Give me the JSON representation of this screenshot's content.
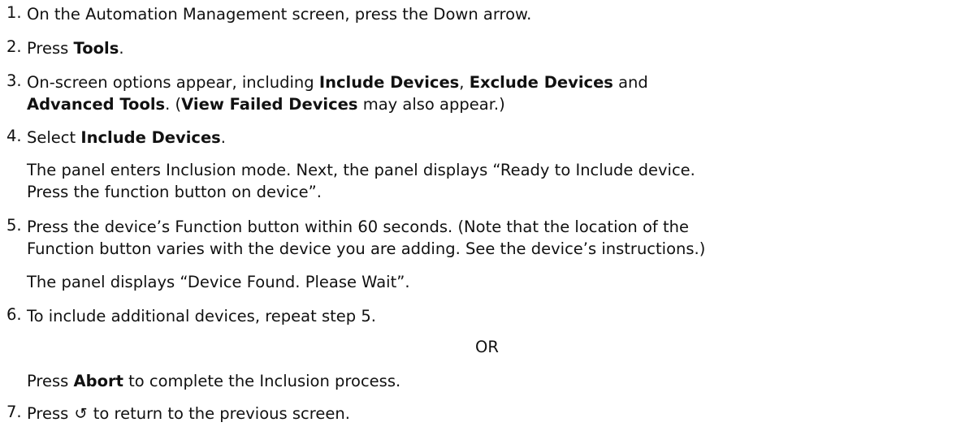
{
  "steps": [
    {
      "number": "1.",
      "text": "On the Automation Management screen, press the Down arrow."
    },
    {
      "number": "2.",
      "pre": "Press ",
      "bold": "Tools",
      "post": "."
    },
    {
      "number": "3.",
      "line1_pre": "On-screen options appear, including ",
      "line1_bold1": "Include Devices",
      "line1_mid": ", ",
      "line1_bold2": "Exclude Devices",
      "line1_post": " and",
      "line2_bold1": "Advanced Tools",
      "line2_mid": ". (",
      "line2_bold2": "View Failed Devices",
      "line2_post": " may also appear.)"
    },
    {
      "number": "4.",
      "pre": "Select ",
      "bold": "Include Devices",
      "post": ".",
      "note_line1": "The panel enters Inclusion mode. Next, the panel displays “Ready to Include device.",
      "note_line2": "Press the function button on device”."
    },
    {
      "number": "5.",
      "line1": "Press the device’s Function button within 60 seconds. (Note that the location of the",
      "line2": "Function button varies with the device you are adding. See the device’s instructions.)",
      "note": "The panel displays “Device Found. Please Wait”."
    },
    {
      "number": "6.",
      "text": "To include additional devices, repeat step 5.",
      "or": "OR",
      "alt_pre": "Press ",
      "alt_bold": "Abort",
      "alt_post": " to complete the Inclusion process."
    },
    {
      "number": "7.",
      "pre": "Press ",
      "icon": "back-arrow-icon",
      "icon_glyph": "↺",
      "post": " to return to the previous screen."
    }
  ]
}
